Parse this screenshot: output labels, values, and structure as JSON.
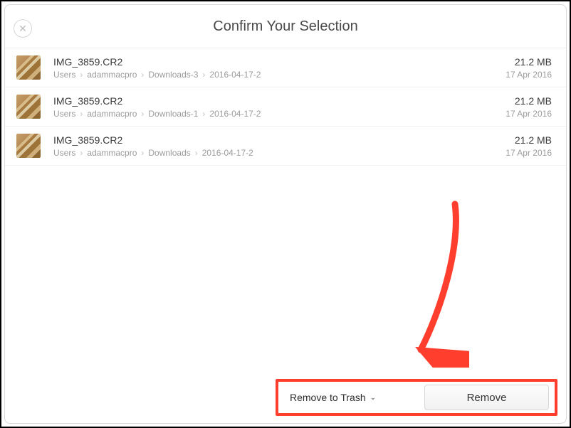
{
  "header": {
    "title": "Confirm Your Selection"
  },
  "files": [
    {
      "name": "IMG_3859.CR2",
      "path": [
        "Users",
        "adammacpro",
        "Downloads-3",
        "2016-04-17-2"
      ],
      "size": "21.2 MB",
      "date": "17 Apr 2016"
    },
    {
      "name": "IMG_3859.CR2",
      "path": [
        "Users",
        "adammacpro",
        "Downloads-1",
        "2016-04-17-2"
      ],
      "size": "21.2 MB",
      "date": "17 Apr 2016"
    },
    {
      "name": "IMG_3859.CR2",
      "path": [
        "Users",
        "adammacpro",
        "Downloads",
        "2016-04-17-2"
      ],
      "size": "21.2 MB",
      "date": "17 Apr 2016"
    }
  ],
  "footer": {
    "dropdown_label": "Remove to Trash",
    "remove_label": "Remove"
  },
  "annotation": {
    "arrow_color": "#ff3e2e"
  }
}
